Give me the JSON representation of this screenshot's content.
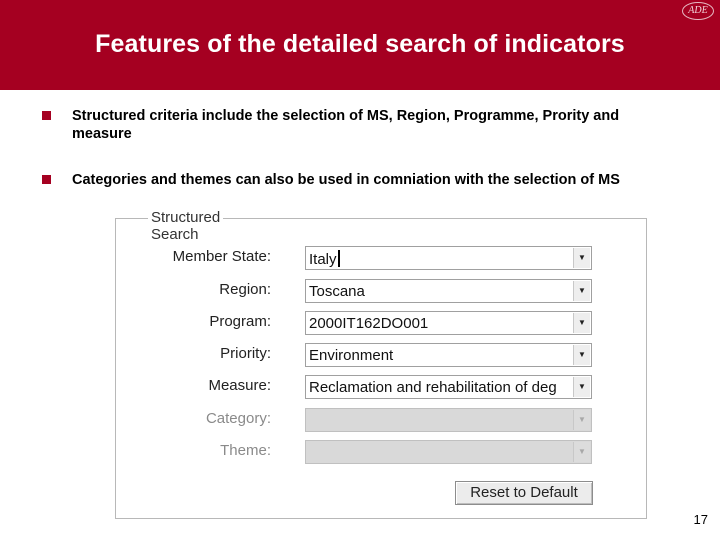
{
  "slide": {
    "title": "Features of the detailed search of indicators",
    "logo_text": "ADE",
    "page_number": "17",
    "accent_color": "#a50021"
  },
  "bullets": [
    "Structured criteria include the selection of MS, Region, Programme, Prority and measure",
    "Categories and themes can also be used in comniation with the selection of MS"
  ],
  "form": {
    "legend": "Structured Search",
    "fields": [
      {
        "label": "Member State:",
        "value": "Italy",
        "enabled": true,
        "focused": true
      },
      {
        "label": "Region:",
        "value": "Toscana",
        "enabled": true
      },
      {
        "label": "Program:",
        "value": "2000IT162DO001",
        "enabled": true
      },
      {
        "label": "Priority:",
        "value": "Environment",
        "enabled": true
      },
      {
        "label": "Measure:",
        "value": "Reclamation and rehabilitation of deg",
        "enabled": true
      },
      {
        "label": "Category:",
        "value": "",
        "enabled": false
      },
      {
        "label": "Theme:",
        "value": "",
        "enabled": false
      }
    ],
    "reset_label": "Reset to Default",
    "dropdown_icon": "chevron-down-icon"
  }
}
